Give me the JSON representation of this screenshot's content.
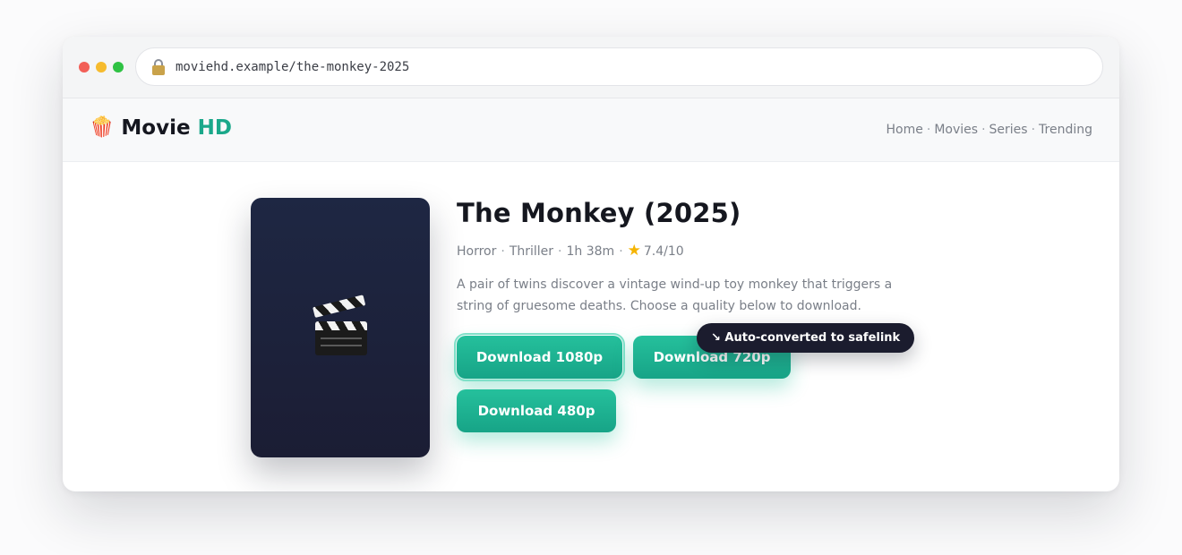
{
  "browser": {
    "url": "moviehd.example/the-monkey-2025"
  },
  "site": {
    "logo_main": "Movie",
    "logo_accent": "HD",
    "nav": [
      "Home",
      "Movies",
      "Series",
      "Trending"
    ],
    "nav_separator": "·"
  },
  "movie": {
    "title": "The Monkey (2025)",
    "genre_1": "Horror",
    "genre_2": "Thriller",
    "runtime": "1h 38m",
    "rating": "7.4/10",
    "description": "A pair of twins discover a vintage wind-up toy monkey that triggers a string of gruesome deaths. Choose a quality below to download."
  },
  "downloads": {
    "btn_1080": "Download 1080p",
    "btn_720": "Download 720p",
    "btn_480": "Download 480p"
  },
  "tooltip": {
    "text": "↘ Auto-converted to safelink"
  },
  "colors": {
    "accent": "#1aa88a",
    "button": "#1fb594",
    "tooltip_bg": "#1b1c2e",
    "poster_bg": "#1e2743"
  },
  "icons": {
    "logo": "popcorn-icon",
    "poster": "clapper-board-icon",
    "rating": "star-icon",
    "address": "lock-icon"
  }
}
